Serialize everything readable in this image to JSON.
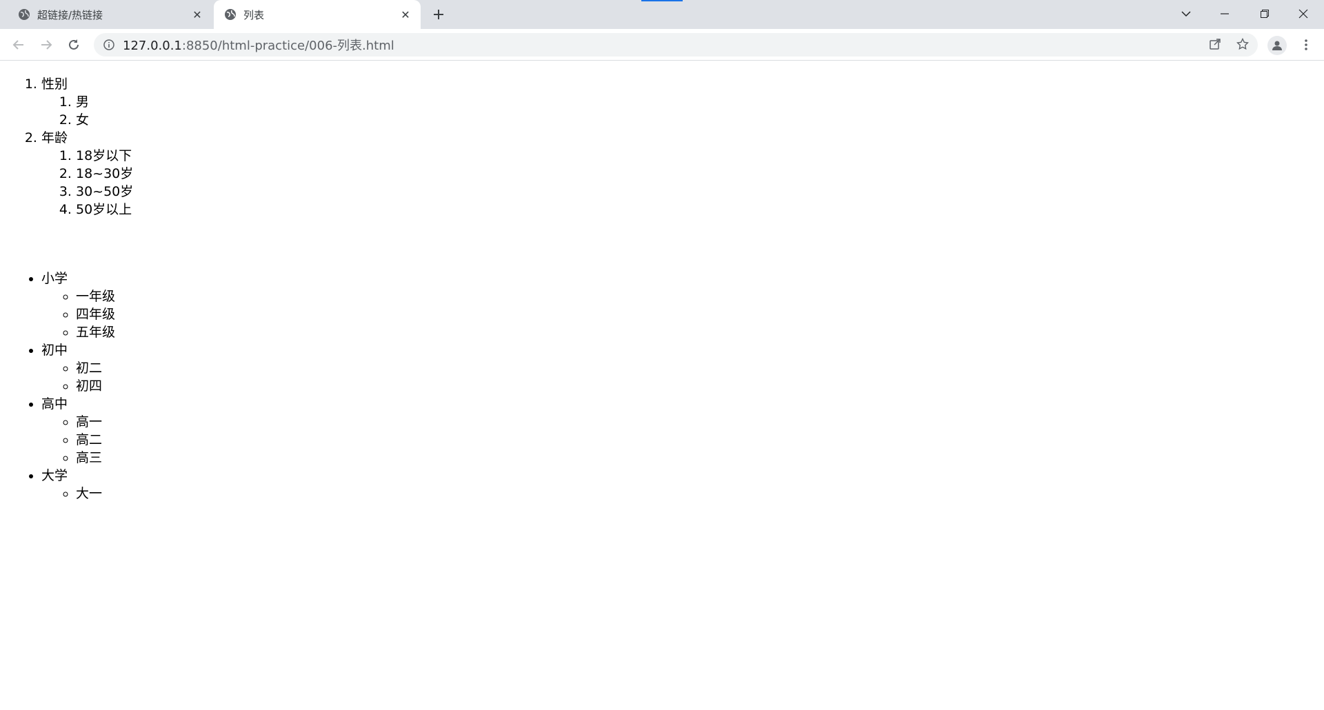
{
  "tabs": [
    {
      "title": "超链接/热链接",
      "active": false
    },
    {
      "title": "列表",
      "active": true
    }
  ],
  "address": {
    "host": "127.0.0.1",
    "path": ":8850/html-practice/006-列表.html"
  },
  "ordered_list": [
    {
      "label": "性别",
      "children": [
        "男",
        "女"
      ]
    },
    {
      "label": "年龄",
      "children": [
        "18岁以下",
        "18~30岁",
        "30~50岁",
        "50岁以上"
      ]
    }
  ],
  "unordered_list": [
    {
      "label": "小学",
      "children": [
        "一年级",
        "四年级",
        "五年级"
      ]
    },
    {
      "label": "初中",
      "children": [
        "初二",
        "初四"
      ]
    },
    {
      "label": "高中",
      "children": [
        "高一",
        "高二",
        "高三"
      ]
    },
    {
      "label": "大学",
      "children": [
        "大一"
      ]
    }
  ]
}
